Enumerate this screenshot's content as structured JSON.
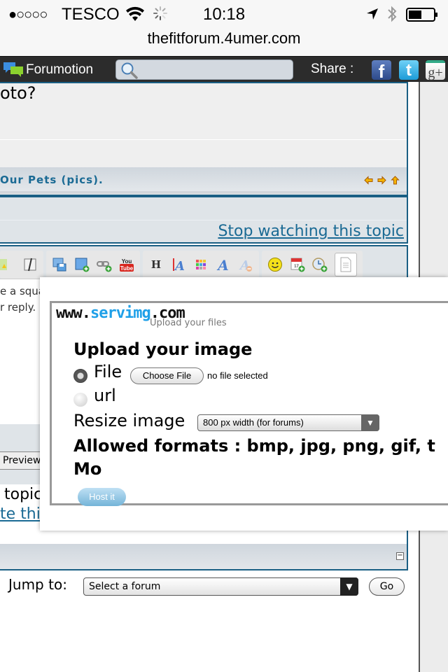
{
  "status_bar": {
    "signal": "●○○○○",
    "carrier": "TESCO",
    "time": "10:18",
    "icons": [
      "wifi-icon",
      "activity-spinner-icon",
      "location-arrow-icon",
      "bluetooth-icon",
      "battery-icon"
    ]
  },
  "browser": {
    "url": "thefitforum.4umer.com"
  },
  "forumotion_bar": {
    "brand": "Forumotion",
    "search_placeholder": "",
    "share_label": "Share :",
    "social": {
      "facebook": "f",
      "twitter": "t",
      "google_plus": "g+"
    }
  },
  "topic": {
    "question_fragment": "oto?",
    "category_title": "Our Pets (pics).",
    "nav": {
      "prev": "◆",
      "next": "◆",
      "up": "▲"
    },
    "stop_watching": "Stop watching this topic"
  },
  "editor": {
    "toolbar_groups": [
      [
        "spoiler-icon",
        "code-icon"
      ],
      [
        "host-image-icon",
        "insert-image-icon",
        "insert-link-icon",
        "youtube-icon"
      ],
      [
        "heading-icon",
        "font-size-icon",
        "color-icon",
        "font-icon",
        "remove-format-icon"
      ],
      [
        "smiley-icon",
        "date-icon",
        "time-icon",
        "source-mode-icon"
      ]
    ],
    "heading_glyph": "H",
    "youtube_label": "YouTube",
    "body_line1": "e a squa",
    "body_line2": "r reply.",
    "preview_button": "Preview"
  },
  "footer": {
    "topic_fragment": "topic",
    "forum_link": "te this forum",
    "collapse": "−",
    "jump_label": "Jump to:",
    "jump_select": "Select a forum",
    "go_button": "Go"
  },
  "upload_popup": {
    "logo_prefix": "www.",
    "logo_brand": "servimg",
    "logo_suffix": ".com",
    "tagline": "Upload your files",
    "title": "Upload your image",
    "source_options": [
      {
        "label": "File",
        "selected": true
      },
      {
        "label": "url",
        "selected": false
      }
    ],
    "choose_file_button": "Choose File",
    "file_status": "no file selected",
    "resize_label": "Resize image",
    "resize_value": "800 px width (for forums)",
    "formats_line1": "Allowed formats : bmp, jpg, png, gif, t",
    "formats_line2": "Mo",
    "host_button": "Host it"
  }
}
